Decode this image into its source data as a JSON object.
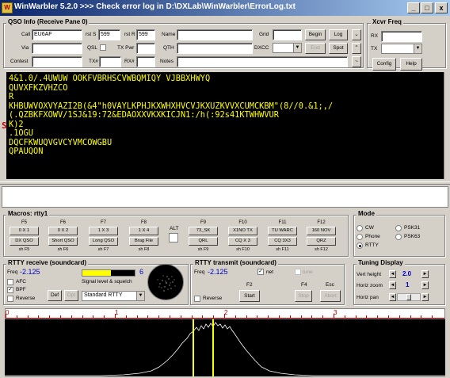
{
  "window": {
    "title": "WinWarbler 5.2.0 >>> Check error log in D:\\DXLab\\WinWarbler\\ErrorLog.txt",
    "icon_glyph": "W",
    "controls": [
      "_",
      "□",
      "x"
    ]
  },
  "qso": {
    "group_label": "QSO Info (Receive Pane 0)",
    "call_label": "Call",
    "call_value": "EU6AF",
    "rsts_label": "rst S",
    "rsts_value": "599",
    "rstr_label": "rst R",
    "rstr_value": "599",
    "name_label": "Name",
    "name_value": "",
    "grid_label": "Grid",
    "grid_value": "",
    "via_label": "Via",
    "via_value": "",
    "qsl_label": "QSL",
    "txpwr_label": "TX Pwr",
    "txpwr_value": "",
    "qth_label": "QTH",
    "qth_value": "",
    "dxcc_label": "DXCC",
    "dxcc_value": "",
    "contest_label": "Contest",
    "contest_value": "",
    "tx_label": "TX#",
    "tx_value": "",
    "rx_label": "RX#",
    "rx_value": "",
    "notes_label": "Notes",
    "notes_value": "",
    "begin_label": "Begin",
    "log_label": "Log",
    "end_label": "End",
    "spot_label": "Spot",
    "tilde_label": "~"
  },
  "xcvr": {
    "group_label": "Xcvr Freq",
    "rx_label": "RX",
    "rx_value": "",
    "tx_label": "TX",
    "tx_value": "",
    "config_label": "Config",
    "help_label": "Help"
  },
  "receive_pane": {
    "marker": "S",
    "lines": [
      "4&1.0/.4UWUW OOKFVBRHSCVWBQMIQY VJBBXHWYQ",
      "QUVXFKZVHZCO",
      "R",
      "KHBUWVOXVYAZI2B(&4\"h0VAYLKPHJKXWHXHVCVJKXUZKVVXCUMCKBM\"(8//0.&1;,/",
      "(.QZBKFXOWV/1SJ&19:72&EDAOXXVKXKICJN1:/h(:92s41KTWHWVUR",
      "K)2",
      ".1OGU",
      "",
      "DQCFKWUQVGVCYVMCOWGBU",
      "QPAUQON"
    ]
  },
  "macros": {
    "group_label": "Macros: rtty1",
    "alt_label": "ALT",
    "fkeys": [
      "F5",
      "F6",
      "F7",
      "F8",
      "F9",
      "F10",
      "F11",
      "F12"
    ],
    "row1": [
      "0 X 1",
      "0 X 2",
      "1 X 3",
      "1 X 4",
      "73_SK",
      "X1NO TX",
      "TU WARC",
      "160 NOV"
    ],
    "row2": [
      "DX QSO",
      "Short QSO",
      "Long QSO",
      "Brag File",
      "QRL",
      "CQ X 3",
      "CQ 3X3",
      "QRZ"
    ],
    "shkeys": [
      "sh F5",
      "sh F6",
      "sh F7",
      "sh F8",
      "sh F9",
      "sh F10",
      "sh F11",
      "sh F12"
    ]
  },
  "mode": {
    "group_label": "Mode",
    "options": [
      "CW",
      "Phone",
      "RTTY",
      "PSK31",
      "PSK63"
    ],
    "selected": "RTTY"
  },
  "rtty_rx": {
    "group_label": "RTTY receive (soundcard)",
    "freq_label": "Freq",
    "freq_value": "-2.125",
    "squelch_value": "6",
    "squelch_caption": "Signal level & squelch",
    "signal_level": 0.55,
    "afc_label": "AFC",
    "bpf_label": "BPF",
    "reverse_label": "Reverse",
    "def_label": "Def",
    "opt_label": "Opt",
    "profile_value": "Standard RTTY"
  },
  "rtty_tx": {
    "group_label": "RTTY transmit (soundcard)",
    "freq_label": "Freq",
    "freq_value": "-2.125",
    "net_label": "net",
    "tune_label": "tune",
    "reverse_label": "Reverse",
    "f2_label": "F2",
    "f4_label": "F4",
    "esc_label": "Esc",
    "start_label": "Start",
    "stop_label": "Stop",
    "abort_label": "Abort"
  },
  "tuning": {
    "group_label": "Tuning Display",
    "vert_label": "Vert height",
    "vert_value": "2.0",
    "horiz_label": "Horiz zoom",
    "horiz_value": "1",
    "pan_label": "Horiz pan",
    "pan_level": 0.5
  },
  "scale": {
    "ticks": [
      "0",
      "1",
      "2",
      "3"
    ]
  },
  "colors": {
    "rx_text": "#ffff00",
    "rx_bg": "#000000",
    "accent_blue": "#0000c0",
    "scale_red": "#c00000"
  }
}
